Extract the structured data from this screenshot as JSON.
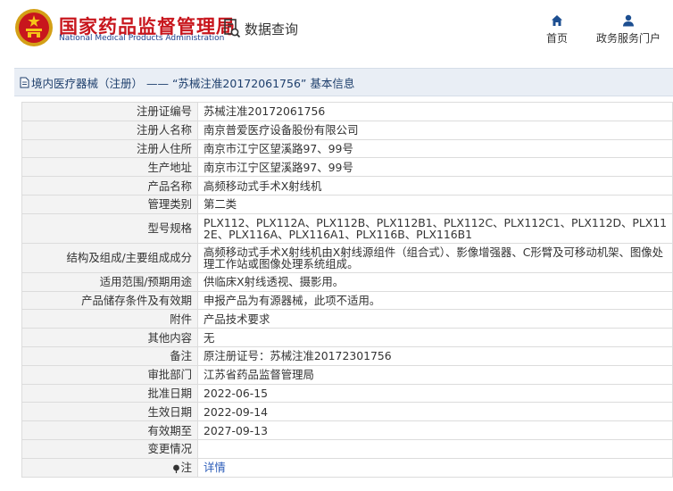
{
  "header": {
    "brand_cn": "国家药品监督管理局",
    "brand_en": "National Medical Products Administration",
    "query_label": "数据查询",
    "nav": [
      {
        "label": "首页",
        "icon": "home-icon"
      },
      {
        "label": "政务服务门户",
        "icon": "user-icon"
      }
    ]
  },
  "breadcrumb": {
    "text": "境内医疗器械（注册） —— “苏械注准20172061756” 基本信息"
  },
  "record": {
    "rows": [
      {
        "key": "注册证编号",
        "value": "苏械注准20172061756"
      },
      {
        "key": "注册人名称",
        "value": "南京普爱医疗设备股份有限公司"
      },
      {
        "key": "注册人住所",
        "value": "南京市江宁区望溪路97、99号"
      },
      {
        "key": "生产地址",
        "value": "南京市江宁区望溪路97、99号"
      },
      {
        "key": "产品名称",
        "value": "高频移动式手术X射线机"
      },
      {
        "key": "管理类别",
        "value": "第二类"
      },
      {
        "key": "型号规格",
        "value": "PLX112、PLX112A、PLX112B、PLX112B1、PLX112C、PLX112C1、PLX112D、PLX112E、PLX116A、PLX116A1、PLX116B、PLX116B1"
      },
      {
        "key": "结构及组成/主要组成成分",
        "value": "高频移动式手术X射线机由X射线源组件（组合式）、影像增强器、C形臂及可移动机架、图像处理工作站或图像处理系统组成。"
      },
      {
        "key": "适用范围/预期用途",
        "value": "供临床X射线透视、摄影用。"
      },
      {
        "key": "产品储存条件及有效期",
        "value": "申报产品为有源器械，此项不适用。"
      },
      {
        "key": "附件",
        "value": "产品技术要求"
      },
      {
        "key": "其他内容",
        "value": "无"
      },
      {
        "key": "备注",
        "value": "原注册证号：苏械注准20172301756"
      },
      {
        "key": "审批部门",
        "value": "江苏省药品监督管理局"
      },
      {
        "key": "批准日期",
        "value": "2022-06-15"
      },
      {
        "key": "生效日期",
        "value": "2022-09-14"
      },
      {
        "key": "有效期至",
        "value": "2027-09-13"
      },
      {
        "key": "变更情况",
        "value": ""
      }
    ],
    "note_key": "注",
    "note_link": "详情"
  },
  "colors": {
    "brand_red": "#c8161d",
    "brand_blue": "#1c3f8c",
    "bar_bg": "#e9eef5",
    "link": "#2a5bb8"
  }
}
